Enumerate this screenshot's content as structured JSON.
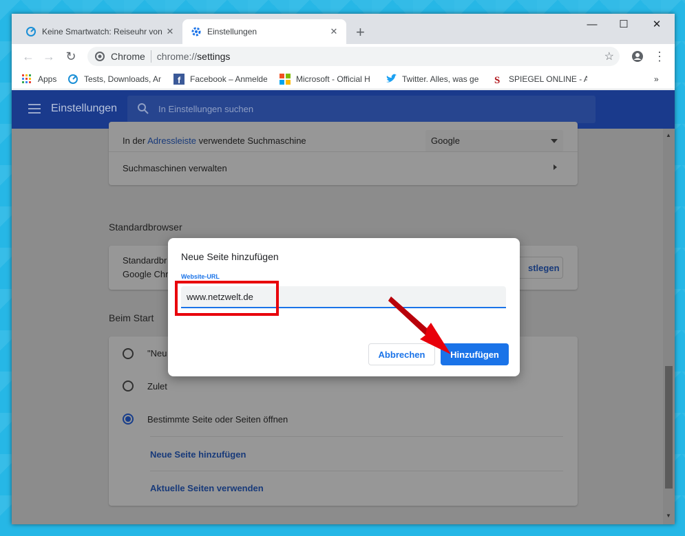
{
  "tabs": [
    {
      "title": "Keine Smartwatch: Reiseuhr von ",
      "icon": "refresh-icon",
      "active": false
    },
    {
      "title": "Einstellungen",
      "icon": "gear-icon",
      "active": true
    }
  ],
  "window_controls": {
    "minimize": "—",
    "maximize": "☐",
    "close": "✕"
  },
  "toolbar": {
    "site_label": "Chrome",
    "url_scheme": "chrome://",
    "url_path": "settings"
  },
  "bookmarks": [
    {
      "label": "Apps",
      "icon": "apps-grid-icon"
    },
    {
      "label": "Tests, Downloads, An",
      "icon": "netzwelt-icon"
    },
    {
      "label": "Facebook – Anmelde",
      "icon": "facebook-icon"
    },
    {
      "label": "Microsoft - Official H",
      "icon": "microsoft-icon"
    },
    {
      "label": "Twitter. Alles, was ge",
      "icon": "twitter-icon"
    },
    {
      "label": "SPIEGEL ONLINE - Ak",
      "icon": "spiegel-icon"
    }
  ],
  "bookmarks_overflow": "»",
  "header": {
    "title": "Einstellungen",
    "search_placeholder": "In Einstellungen suchen"
  },
  "search_engine": {
    "row_prefix": "In der ",
    "row_link": "Adressleiste",
    "row_suffix": " verwendete Suchmaschine",
    "value": "Google",
    "manage_label": "Suchmaschinen verwalten"
  },
  "default_browser": {
    "section_title": "Standardbrowser",
    "line1": "Standardbr",
    "line2": "Google Chr",
    "button_label": "stlegen"
  },
  "startup": {
    "section_title": "Beim Start",
    "options": [
      {
        "label": "\"Neu",
        "checked": false
      },
      {
        "label": "Zulet",
        "checked": false
      },
      {
        "label": "Bestimmte Seite oder Seiten öffnen",
        "checked": true
      }
    ],
    "add_page_link": "Neue Seite hinzufügen",
    "use_current_link": "Aktuelle Seiten verwenden"
  },
  "dialog": {
    "title": "Neue Seite hinzufügen",
    "field_label": "Website-URL",
    "field_value": "www.netzwelt.de",
    "cancel_label": "Abbrechen",
    "add_label": "Hinzufügen"
  },
  "colors": {
    "accent": "#1a73e8",
    "header_bg": "#1a3a8c",
    "annotation_red": "#e8000b"
  }
}
